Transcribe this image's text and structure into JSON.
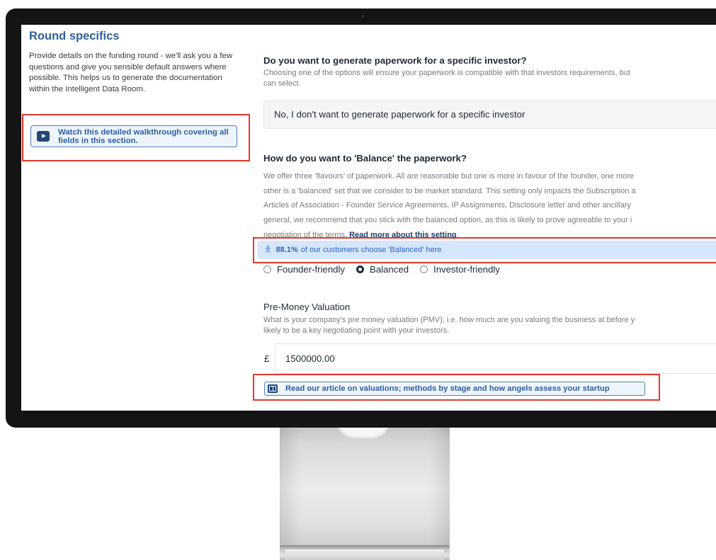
{
  "left": {
    "title": "Round specifics",
    "description": "Provide details on the funding round - we'll ask you a few questions and give you sensible default answers where possible. This helps us to generate the documentation within the Intelligent Data Room.",
    "walkthrough": {
      "icon": "youtube-play-icon",
      "label": "Watch this detailed walkthrough covering all fields in this section."
    }
  },
  "investor": {
    "title": "Do you want to generate paperwork for a specific investor?",
    "desc_line1": "Choosing one of the options will ensure your paperwork is compatible with that investors requirements, but",
    "desc_line2": "can select.",
    "selected": "No, I don't want to generate paperwork for a specific investor"
  },
  "balance": {
    "title": "How do you want to 'Balance' the paperwork?",
    "lines": [
      "We offer three 'flavours' of paperwork. All are reasonable but one is more in favour of the founder, one more",
      "other is a 'balanced' set that we consider to be market standard. This setting only impacts the Subscription a",
      "Articles of Association - Founder Service Agreements, IP Assignments, Disclosure letter and other ancillary",
      "general, we recommend that you stick with the balanced option, as this is likely to prove agreeable to your i"
    ],
    "last_line_prefix": "negotiation of the terms. ",
    "read_more": "Read more about this setting",
    "last_line_suffix": ".",
    "stat": {
      "icon": "person-icon",
      "percent": "88.1%",
      "text": "of our customers choose 'Balanced' here"
    },
    "options": [
      {
        "label": "Founder-friendly",
        "checked": false
      },
      {
        "label": "Balanced",
        "checked": true
      },
      {
        "label": "Investor-friendly",
        "checked": false
      }
    ]
  },
  "pmv": {
    "title": "Pre-Money Valuation",
    "desc_line1": "What is your company's pre money valuation (PMV); i.e. how much are you valuing the business at before y",
    "desc_line2": "likely to be a key negotiating point with your investors.",
    "currency": "£",
    "value": "1500000.00",
    "article": {
      "icon": "book-icon",
      "label": "Read our article on valuations; methods by stage and how angels assess your startup"
    }
  },
  "colors": {
    "accent": "#2f5f9b",
    "highlight": "#e5392e",
    "banner": "#d6e7fb"
  }
}
